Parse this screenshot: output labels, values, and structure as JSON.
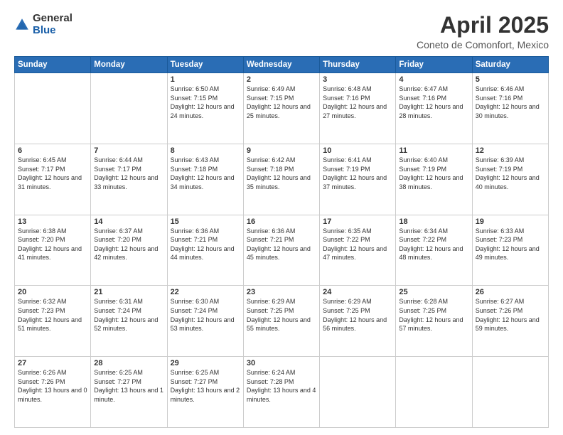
{
  "logo": {
    "general": "General",
    "blue": "Blue"
  },
  "header": {
    "title": "April 2025",
    "subtitle": "Coneto de Comonfort, Mexico"
  },
  "weekdays": [
    "Sunday",
    "Monday",
    "Tuesday",
    "Wednesday",
    "Thursday",
    "Friday",
    "Saturday"
  ],
  "weeks": [
    [
      {
        "day": "",
        "info": ""
      },
      {
        "day": "",
        "info": ""
      },
      {
        "day": "1",
        "info": "Sunrise: 6:50 AM\nSunset: 7:15 PM\nDaylight: 12 hours and 24 minutes."
      },
      {
        "day": "2",
        "info": "Sunrise: 6:49 AM\nSunset: 7:15 PM\nDaylight: 12 hours and 25 minutes."
      },
      {
        "day": "3",
        "info": "Sunrise: 6:48 AM\nSunset: 7:16 PM\nDaylight: 12 hours and 27 minutes."
      },
      {
        "day": "4",
        "info": "Sunrise: 6:47 AM\nSunset: 7:16 PM\nDaylight: 12 hours and 28 minutes."
      },
      {
        "day": "5",
        "info": "Sunrise: 6:46 AM\nSunset: 7:16 PM\nDaylight: 12 hours and 30 minutes."
      }
    ],
    [
      {
        "day": "6",
        "info": "Sunrise: 6:45 AM\nSunset: 7:17 PM\nDaylight: 12 hours and 31 minutes."
      },
      {
        "day": "7",
        "info": "Sunrise: 6:44 AM\nSunset: 7:17 PM\nDaylight: 12 hours and 33 minutes."
      },
      {
        "day": "8",
        "info": "Sunrise: 6:43 AM\nSunset: 7:18 PM\nDaylight: 12 hours and 34 minutes."
      },
      {
        "day": "9",
        "info": "Sunrise: 6:42 AM\nSunset: 7:18 PM\nDaylight: 12 hours and 35 minutes."
      },
      {
        "day": "10",
        "info": "Sunrise: 6:41 AM\nSunset: 7:19 PM\nDaylight: 12 hours and 37 minutes."
      },
      {
        "day": "11",
        "info": "Sunrise: 6:40 AM\nSunset: 7:19 PM\nDaylight: 12 hours and 38 minutes."
      },
      {
        "day": "12",
        "info": "Sunrise: 6:39 AM\nSunset: 7:19 PM\nDaylight: 12 hours and 40 minutes."
      }
    ],
    [
      {
        "day": "13",
        "info": "Sunrise: 6:38 AM\nSunset: 7:20 PM\nDaylight: 12 hours and 41 minutes."
      },
      {
        "day": "14",
        "info": "Sunrise: 6:37 AM\nSunset: 7:20 PM\nDaylight: 12 hours and 42 minutes."
      },
      {
        "day": "15",
        "info": "Sunrise: 6:36 AM\nSunset: 7:21 PM\nDaylight: 12 hours and 44 minutes."
      },
      {
        "day": "16",
        "info": "Sunrise: 6:36 AM\nSunset: 7:21 PM\nDaylight: 12 hours and 45 minutes."
      },
      {
        "day": "17",
        "info": "Sunrise: 6:35 AM\nSunset: 7:22 PM\nDaylight: 12 hours and 47 minutes."
      },
      {
        "day": "18",
        "info": "Sunrise: 6:34 AM\nSunset: 7:22 PM\nDaylight: 12 hours and 48 minutes."
      },
      {
        "day": "19",
        "info": "Sunrise: 6:33 AM\nSunset: 7:23 PM\nDaylight: 12 hours and 49 minutes."
      }
    ],
    [
      {
        "day": "20",
        "info": "Sunrise: 6:32 AM\nSunset: 7:23 PM\nDaylight: 12 hours and 51 minutes."
      },
      {
        "day": "21",
        "info": "Sunrise: 6:31 AM\nSunset: 7:24 PM\nDaylight: 12 hours and 52 minutes."
      },
      {
        "day": "22",
        "info": "Sunrise: 6:30 AM\nSunset: 7:24 PM\nDaylight: 12 hours and 53 minutes."
      },
      {
        "day": "23",
        "info": "Sunrise: 6:29 AM\nSunset: 7:25 PM\nDaylight: 12 hours and 55 minutes."
      },
      {
        "day": "24",
        "info": "Sunrise: 6:29 AM\nSunset: 7:25 PM\nDaylight: 12 hours and 56 minutes."
      },
      {
        "day": "25",
        "info": "Sunrise: 6:28 AM\nSunset: 7:25 PM\nDaylight: 12 hours and 57 minutes."
      },
      {
        "day": "26",
        "info": "Sunrise: 6:27 AM\nSunset: 7:26 PM\nDaylight: 12 hours and 59 minutes."
      }
    ],
    [
      {
        "day": "27",
        "info": "Sunrise: 6:26 AM\nSunset: 7:26 PM\nDaylight: 13 hours and 0 minutes."
      },
      {
        "day": "28",
        "info": "Sunrise: 6:25 AM\nSunset: 7:27 PM\nDaylight: 13 hours and 1 minute."
      },
      {
        "day": "29",
        "info": "Sunrise: 6:25 AM\nSunset: 7:27 PM\nDaylight: 13 hours and 2 minutes."
      },
      {
        "day": "30",
        "info": "Sunrise: 6:24 AM\nSunset: 7:28 PM\nDaylight: 13 hours and 4 minutes."
      },
      {
        "day": "",
        "info": ""
      },
      {
        "day": "",
        "info": ""
      },
      {
        "day": "",
        "info": ""
      }
    ]
  ]
}
